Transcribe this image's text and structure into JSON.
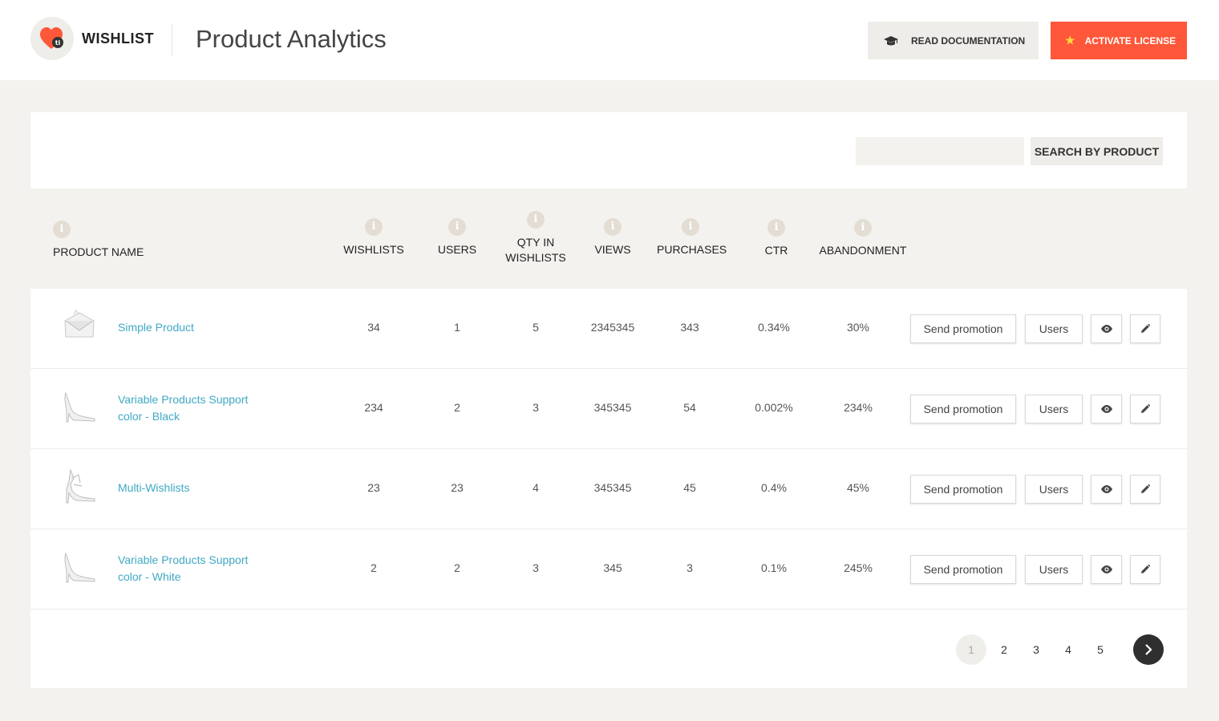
{
  "header": {
    "brand": "WISHLIST",
    "title": "Product Analytics",
    "doc_button": "READ DOCUMENTATION",
    "license_button": "ACTIVATE LICENSE",
    "accent_color": "#ff5739"
  },
  "search": {
    "value": "",
    "button": "SEARCH BY PRODUCT"
  },
  "columns": {
    "product_name": "PRODUCT NAME",
    "wishlists": "WISHLISTS",
    "users": "USERS",
    "qty_line1": "QTY IN",
    "qty_line2": "WISHLISTS",
    "views": "VIEWS",
    "purchases": "PURCHASES",
    "ctr": "CTR",
    "abandonment": "ABANDONMENT",
    "info_glyph": "i"
  },
  "rows": [
    {
      "name_line1": "Simple Product",
      "name_line2": "",
      "image": "envelope-clutch",
      "wishlists": "34",
      "users": "1",
      "qty": "5",
      "views": "2345345",
      "purchases": "343",
      "ctr": "0.34%",
      "abandonment": "30%"
    },
    {
      "name_line1": "Variable Products Support",
      "name_line2": "color - Black",
      "image": "high-heel-shoe",
      "wishlists": "234",
      "users": "2",
      "qty": "3",
      "views": "345345",
      "purchases": "54",
      "ctr": "0.002%",
      "abandonment": "234%"
    },
    {
      "name_line1": "Multi-Wishlists",
      "name_line2": "",
      "image": "strappy-sandal",
      "wishlists": "23",
      "users": "23",
      "qty": "4",
      "views": "345345",
      "purchases": "45",
      "ctr": "0.4%",
      "abandonment": "45%"
    },
    {
      "name_line1": "Variable Products Support",
      "name_line2": "color - White",
      "image": "high-heel-shoe",
      "wishlists": "2",
      "users": "2",
      "qty": "3",
      "views": "345",
      "purchases": "3",
      "ctr": "0.1%",
      "abandonment": "245%"
    }
  ],
  "actions": {
    "send_promotion": "Send promotion",
    "users": "Users",
    "view_icon": "eye-icon",
    "edit_icon": "pencil-icon"
  },
  "pagination": {
    "pages": [
      "1",
      "2",
      "3",
      "4",
      "5"
    ],
    "current": "1",
    "next_icon": "chevron-right-icon"
  }
}
